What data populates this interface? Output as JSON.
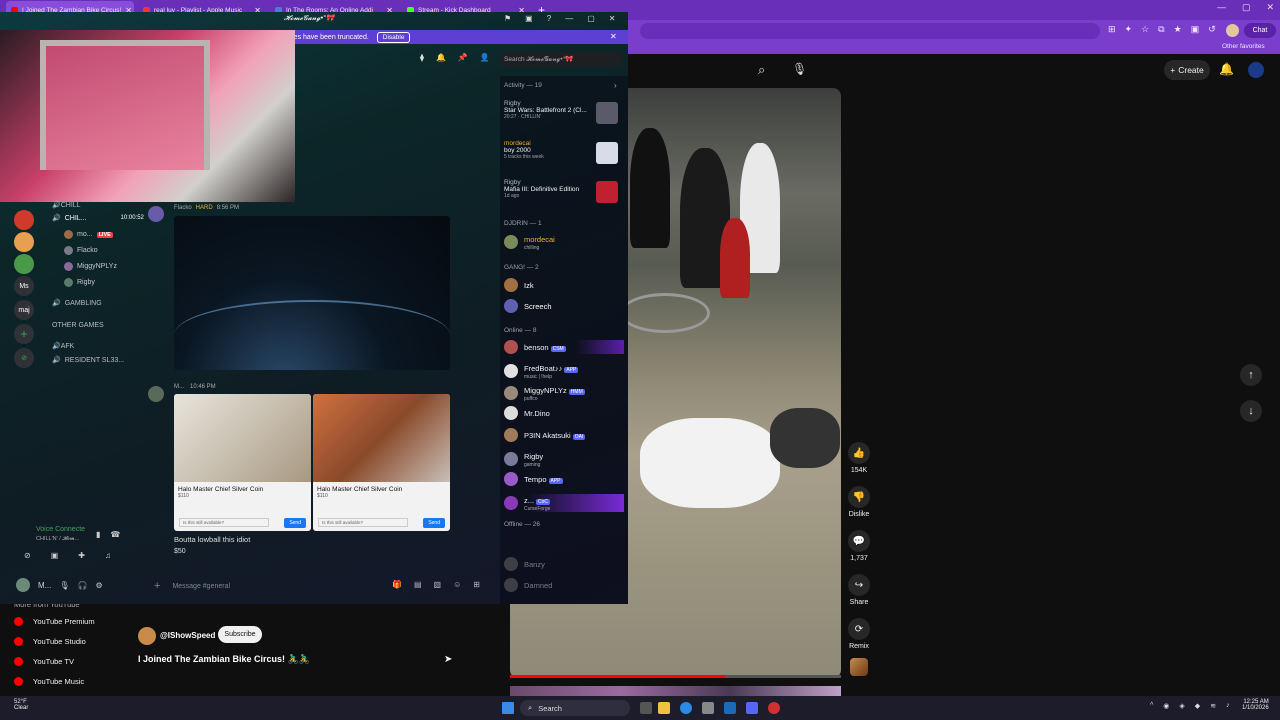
{
  "browser": {
    "tabs": [
      {
        "title": "I Joined The Zambian Bike Circus! ",
        "color": "#ff0000",
        "active": true
      },
      {
        "title": "real luv - Playlist - Apple Music",
        "color": "#fa2d48",
        "active": false
      },
      {
        "title": "In The Rooms: An Online Addi",
        "color": "#4a7bd6",
        "active": false
      },
      {
        "title": "Stream - Kick Dashboard",
        "color": "#53fc18",
        "active": false
      }
    ],
    "new_tab": "+",
    "chat_label": "Chat",
    "other_favorites": "Other favorites"
  },
  "youtube": {
    "create_label": "Create",
    "actions": [
      {
        "icon": "like-icon",
        "glyph": "👍",
        "label": "154K"
      },
      {
        "icon": "dislike-icon",
        "glyph": "👎",
        "label": "Dislike"
      },
      {
        "icon": "comment-icon",
        "glyph": "💬",
        "label": "1,737"
      },
      {
        "icon": "share-icon",
        "glyph": "↪",
        "label": "Share"
      },
      {
        "icon": "remix-icon",
        "glyph": "⟳",
        "label": "Remix"
      }
    ],
    "more_from": "More from YouTube",
    "links": [
      "YouTube Premium",
      "YouTube Studio",
      "YouTube TV",
      "YouTube Music"
    ],
    "channel": "@IShowSpeed",
    "subscribe": "Subscribe",
    "video_title": "I Joined The Zambian Bike Circus! 🚴‍♂️🚴‍♂️",
    "progress": 0.65
  },
  "discord": {
    "title": "𝓗𝓸𝓶𝓮𝓖𝓪𝓷𝓰•°🎀",
    "banner_text": "d. Usernames have been truncated.",
    "banner_button": "Disable",
    "search_placeholder": "Search 𝓗𝓸𝓶𝓮𝓖𝓪𝓷𝓰•°🎀",
    "channels": {
      "chill": "🔊CHILL",
      "chill2": "CHIL...",
      "timer": "10:00:52",
      "gambling": "GAMBLING",
      "other_games": "OTHER GAMES",
      "afk": "🔊AFK",
      "resident": "RESIDENT SL33..."
    },
    "voice_users": [
      {
        "name": "mo...",
        "live": "LIVE"
      },
      {
        "name": "Flacko",
        "live": ""
      },
      {
        "name": "MiggyNPLYz",
        "live": ""
      },
      {
        "name": "Rigby",
        "live": ""
      }
    ],
    "guild_labels": {
      "ms": "Ms",
      "maj": "maj"
    },
    "voice": {
      "status": "Voice Connecte",
      "sub": "CHILL'N' / 𝓗𝓸𝓶..."
    },
    "user_name": "M...",
    "msg1": {
      "author": "Flacko",
      "tag": "HARD",
      "time": "8:56 PM"
    },
    "msg2": {
      "author": "M...",
      "time": "10:46 PM"
    },
    "cards": [
      {
        "title": "Halo Master Chief Silver Coin",
        "price": "$110",
        "ask": "Is this still available?",
        "send": "Send"
      },
      {
        "title": "Halo Master Chief Silver Coin",
        "price": "$110",
        "ask": "Is this still available?",
        "send": "Send"
      }
    ],
    "message_text": "Boutta lowball this idiot",
    "message_price": "$50",
    "composer_placeholder": "Message #general",
    "activity_header": "Activity — 19",
    "activities": [
      {
        "name": "Rigby",
        "game": "Star Wars: Battlefront 2 (Cl...",
        "sub": "20:27 · CHILLIN'"
      },
      {
        "name": "mordecai",
        "game": "boy 2000",
        "sub": "5 tracks this week"
      },
      {
        "name": "Rigby",
        "game": "Mafia III: Definitive Edition",
        "sub": "1d ago"
      }
    ],
    "sections": {
      "djdrin": "DJDRIN — 1",
      "gang": "GANG! — 2",
      "online": "Online — 8",
      "offline": "Offline — 26"
    },
    "dj_members": [
      {
        "name": "mordecai",
        "status": "chilling",
        "color": "#f0b232"
      }
    ],
    "gang_members": [
      {
        "name": "Izk",
        "status": ""
      },
      {
        "name": "Screech",
        "status": ""
      }
    ],
    "online_members": [
      {
        "name": "benson",
        "badge": "CSM",
        "status": ""
      },
      {
        "name": "FredBoat♪♪",
        "badge": "APP",
        "status": "music | !help"
      },
      {
        "name": "MiggyNPLYz",
        "badge": "HMM",
        "status": "puffco"
      },
      {
        "name": "Mr.Dino",
        "badge": "",
        "status": ""
      },
      {
        "name": "P3IN Akatsuki",
        "badge": "OAI",
        "status": ""
      },
      {
        "name": "Rigby",
        "badge": "",
        "status": "gaming"
      },
      {
        "name": "Tempo",
        "badge": "APP",
        "status": ""
      },
      {
        "name": "z...",
        "badge": "CoC",
        "status": "CurseForge"
      }
    ],
    "offline_members": [
      "Banzy",
      "Damned"
    ]
  },
  "taskbar": {
    "weather_temp": "52°F",
    "weather_text": "Clear",
    "search": "Search",
    "time": "12:25 AM",
    "date": "1/10/2026"
  }
}
